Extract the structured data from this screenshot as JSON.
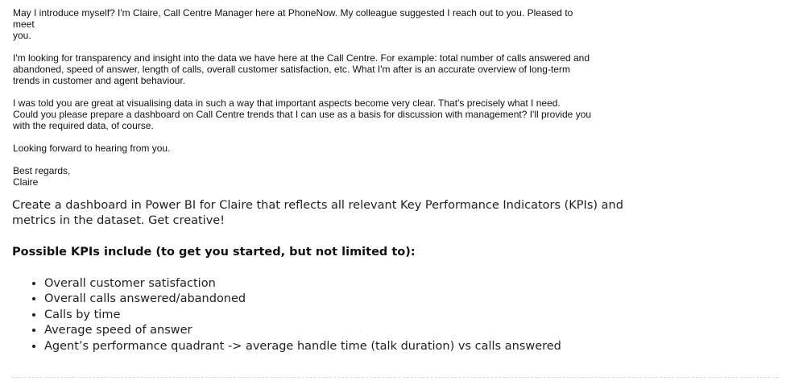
{
  "email": {
    "intro_line1": "May I introduce myself? I'm Claire, Call Centre Manager here at PhoneNow. My colleague suggested I reach out to you. Pleased to meet",
    "intro_line2": "you.",
    "request_line1": "I'm looking for transparency and insight into the data we have here at the Call Centre. For example: total number of calls answered and",
    "request_line2": "abandoned, speed of answer, length of calls, overall customer satisfaction, etc. What I'm after is an accurate overview of long-term",
    "request_line3": "trends in customer and agent behaviour.",
    "ask_line1": "I was told you are great at visualising data in such a way that important aspects become very clear. That's precisely what I need.",
    "ask_line2": "Could you please prepare a dashboard on Call Centre trends that I can use as a basis for discussion with management? I'll provide you",
    "ask_line3": "with the required data, of course.",
    "closing": "Looking forward to hearing from you.",
    "signoff": "Best regards,",
    "signature": "Claire"
  },
  "brief": {
    "intro": "Create a dashboard in Power BI for Claire that reflects all relevant Key Performance Indicators (KPIs) and metrics in the dataset. Get creative!",
    "kpi_heading": "Possible KPIs include (to get you started, but not limited to):",
    "kpis": [
      "Overall customer satisfaction",
      "Overall calls answered/abandoned",
      "Calls by time",
      "Average speed of answer",
      "Agent’s performance quadrant -> average handle time (talk duration) vs calls answered"
    ]
  }
}
